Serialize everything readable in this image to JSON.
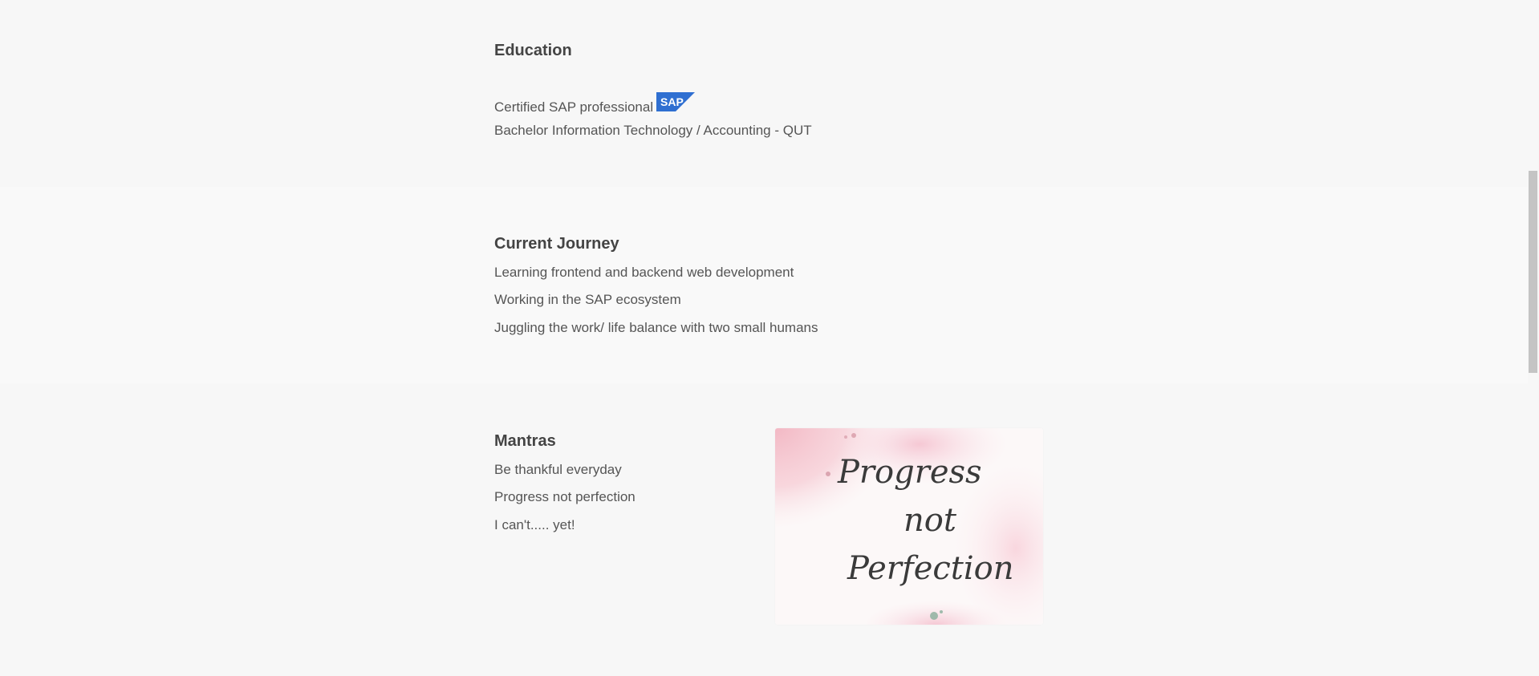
{
  "education": {
    "title": "Education",
    "items": [
      "Certified SAP professional",
      "Bachelor Information Technology / Accounting - QUT"
    ],
    "sap_logo_text": "SAP",
    "sap_logo_color": "#2f6fd1"
  },
  "journey": {
    "title": "Current Journey",
    "items": [
      "Learning frontend and backend web development",
      "Working in the SAP ecosystem",
      "Juggling the work/ life balance with two small humans"
    ]
  },
  "mantras": {
    "title": "Mantras",
    "items": [
      "Be thankful everyday",
      "Progress not perfection",
      "I can't..... yet!"
    ],
    "poster": {
      "line1": "Progress",
      "line2": "not",
      "line3": "Perfection"
    }
  }
}
